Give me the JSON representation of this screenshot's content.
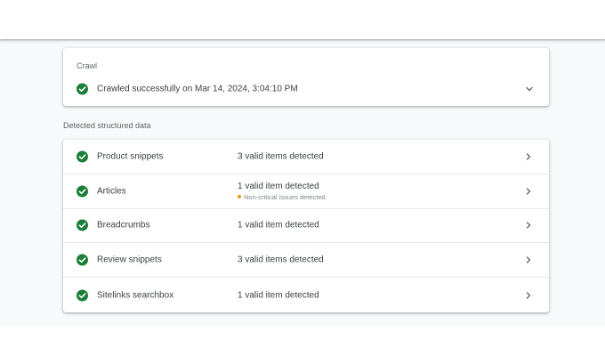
{
  "crawl": {
    "heading": "Crawl",
    "status_text": "Crawled successfully on Mar 14, 2024, 3:04:10 PM",
    "status_icon": "check-circle-icon",
    "expand_icon": "chevron-down-icon"
  },
  "structured_data": {
    "label": "Detected structured data",
    "items": [
      {
        "name": "Product snippets",
        "status": "3 valid items detected",
        "warning": ""
      },
      {
        "name": "Articles",
        "status": "1 valid item detected",
        "warning": "Non-critical issues detected"
      },
      {
        "name": "Breadcrumbs",
        "status": "1 valid item detected",
        "warning": ""
      },
      {
        "name": "Review snippets",
        "status": "3 valid items detected",
        "warning": ""
      },
      {
        "name": "Sitelinks searchbox",
        "status": "1 valid item detected",
        "warning": ""
      }
    ]
  },
  "colors": {
    "success": "#188038",
    "warning": "#f29900",
    "text": "#3c4043",
    "muted": "#5f6368"
  }
}
